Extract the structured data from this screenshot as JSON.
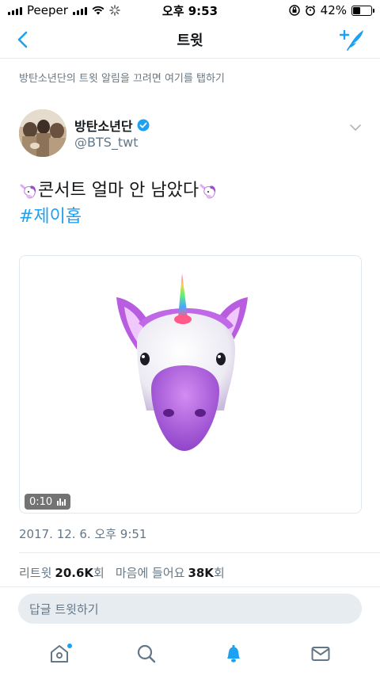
{
  "status_bar": {
    "carrier": "Peeper",
    "time": "오후 9:53",
    "battery_percent": "42%",
    "battery_level": 0.42
  },
  "nav": {
    "title": "트윗",
    "back_icon": "chevron-left-icon",
    "compose_icon": "compose-tweet-icon"
  },
  "notice_text": "방탄소년단의 트윗 알림을 끄려면 여기를 탭하기",
  "author": {
    "name": "방탄소년단",
    "handle": "@BTS_twt",
    "verified": true
  },
  "tweet": {
    "line1_text": "콘서트 얼마 안 남았다",
    "hashtag": "#제이홉",
    "emoji": "unicorn-emoji"
  },
  "media": {
    "type": "video",
    "duration": "0:10"
  },
  "timestamp": "2017. 12. 6. 오후 9:51",
  "stats": {
    "retweet_label": "리트윗",
    "retweet_count": "20.6K",
    "retweet_unit": "회",
    "like_label": "마음에 들어요",
    "like_count": "38K",
    "like_unit": "회"
  },
  "reply": {
    "placeholder": "답글 트윗하기"
  },
  "tabs": [
    {
      "name": "home",
      "icon": "home-icon"
    },
    {
      "name": "search",
      "icon": "search-icon"
    },
    {
      "name": "notifications",
      "icon": "bell-icon",
      "active": true
    },
    {
      "name": "messages",
      "icon": "mail-icon"
    }
  ],
  "colors": {
    "accent": "#1da1f2",
    "secondary_text": "#657786",
    "divider": "#e6ecf0"
  }
}
